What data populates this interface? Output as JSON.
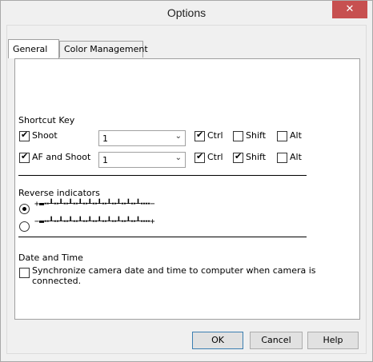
{
  "window": {
    "title": "Options",
    "close_glyph": "✕"
  },
  "tabs": [
    {
      "label": "General",
      "active": true
    },
    {
      "label": "Color Management",
      "active": false
    }
  ],
  "shortcut": {
    "heading": "Shortcut Key",
    "rows": [
      {
        "label": "Shoot",
        "checked": true,
        "value": "1",
        "ctrl": true,
        "shift": false,
        "alt": false
      },
      {
        "label": "AF and Shoot",
        "checked": true,
        "value": "1",
        "ctrl": true,
        "shift": true,
        "alt": false
      }
    ],
    "ctrl_label": "Ctrl",
    "shift_label": "Shift",
    "alt_label": "Alt"
  },
  "reverse": {
    "heading": "Reverse indicators",
    "option1": {
      "selected": true,
      "left_sign": "+",
      "right_sign": "−"
    },
    "option2": {
      "selected": false,
      "left_sign": "−",
      "right_sign": "+"
    }
  },
  "datetime": {
    "heading": "Date and Time",
    "sync_label_line1": "Synchronize camera date and time to computer when camera is",
    "sync_label_line2": "connected.",
    "checked": false
  },
  "buttons": {
    "ok": "OK",
    "cancel": "Cancel",
    "help": "Help"
  },
  "icons": {
    "check": "check-icon",
    "dropdown": "chevron-down-icon",
    "close": "close-icon"
  }
}
